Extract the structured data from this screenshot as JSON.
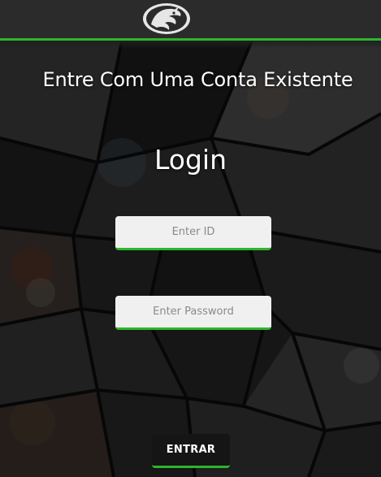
{
  "header": {
    "logo_icon": "dragon-logo-icon",
    "accent_color": "#2db52d",
    "background_color": "#2b2b2b"
  },
  "main": {
    "headline": "Entre Com Uma Conta Existente",
    "title": "Login",
    "id_field": {
      "placeholder": "Enter ID",
      "value": ""
    },
    "password_field": {
      "placeholder": "Enter Password",
      "value": ""
    },
    "submit_label": "ENTRAR"
  }
}
